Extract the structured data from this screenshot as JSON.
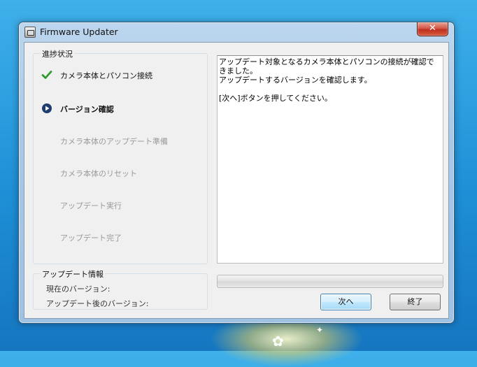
{
  "window": {
    "title": "Firmware Updater",
    "close_label": "✕"
  },
  "steps_panel": {
    "title": "進捗状況",
    "steps": [
      {
        "label": "カメラ本体とパソコン接続",
        "state": "done",
        "icon": "check-icon"
      },
      {
        "label": "バージョン確認",
        "state": "current",
        "icon": "play-circle-icon"
      },
      {
        "label": "カメラ本体のアップデート準備",
        "state": "pending"
      },
      {
        "label": "カメラ本体のリセット",
        "state": "pending"
      },
      {
        "label": "アップデート実行",
        "state": "pending"
      },
      {
        "label": "アップデート完了",
        "state": "pending"
      }
    ]
  },
  "update_info": {
    "title": "アップデート情報",
    "current_version_label": "現在のバージョン:",
    "target_version_label": "アップデート後のバージョン:"
  },
  "message": {
    "text": "アップデート対象となるカメラ本体とパソコンの接続が確認できました。\nアップデートするバージョンを確認します。\n\n[次へ]ボタンを押してください。"
  },
  "progress": {
    "value": 0
  },
  "buttons": {
    "next_label": "次へ",
    "exit_label": "終了"
  },
  "colors": {
    "check": "#2e9a2e",
    "current": "#1f3c6e",
    "pending_text": "#9a9a9a",
    "desktop": "#1e8fd6"
  }
}
